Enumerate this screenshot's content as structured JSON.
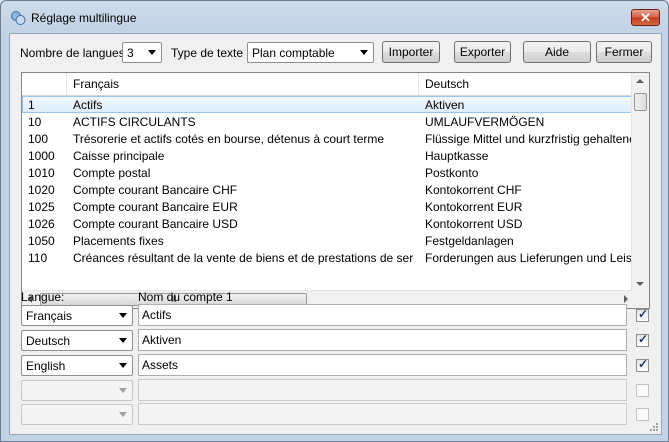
{
  "window": {
    "title": "Réglage multilingue",
    "close_label": "✕"
  },
  "toolbar": {
    "lang_count_label": "Nombre de langues :",
    "lang_count_value": "3",
    "text_type_label": "Type de texte :",
    "text_type_value": "Plan comptable",
    "import_label": "Importer",
    "export_label": "Exporter",
    "help_label": "Aide",
    "close_label": "Fermer"
  },
  "grid": {
    "columns": [
      "",
      "Français",
      "Deutsch"
    ],
    "rows": [
      [
        "1",
        "Actifs",
        "Aktiven"
      ],
      [
        "10",
        "ACTIFS CIRCULANTS",
        "UMLAUFVERMÖGEN"
      ],
      [
        "100",
        "Trésorerie et actifs cotés en bourse, détenus à court terme",
        "Flüssige Mittel und kurzfristig gehaltene Aktiven"
      ],
      [
        "1000",
        "Caisse principale",
        "Hauptkasse"
      ],
      [
        "1010",
        "Compte postal",
        "Postkonto"
      ],
      [
        "1020",
        "Compte courant Bancaire CHF",
        "Kontokorrent CHF"
      ],
      [
        "1025",
        "Compte courant Bancaire EUR",
        "Kontokorrent EUR"
      ],
      [
        "1026",
        "Compte courant Bancaire USD",
        "Kontokorrent USD"
      ],
      [
        "1050",
        "Placements fixes",
        "Festgeldanlagen"
      ],
      [
        "110",
        "Créances résultant de la vente de biens et de prestations de service (",
        "Forderungen aus Lieferungen und Leistungen"
      ]
    ],
    "hthumb_label": "III"
  },
  "editor": {
    "language_label": "Langue:",
    "account_name_label": "Nom du compte 1",
    "rows": [
      {
        "language": "Français",
        "value": "Actifs",
        "checked": "✓"
      },
      {
        "language": "Deutsch",
        "value": "Aktiven",
        "checked": "✓"
      },
      {
        "language": "English",
        "value": "Assets",
        "checked": "✓"
      },
      {
        "language": "",
        "value": "",
        "checked": ""
      },
      {
        "language": "",
        "value": "",
        "checked": ""
      }
    ]
  }
}
